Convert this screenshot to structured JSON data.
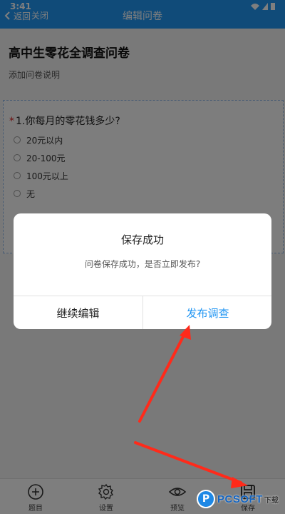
{
  "status_bar": {
    "time": "3:41"
  },
  "header": {
    "back_label": "返回",
    "close_label": "关闭",
    "title": "编辑问卷"
  },
  "survey": {
    "title": "高中生零花全调查问卷",
    "description_placeholder": "添加问卷说明"
  },
  "question": {
    "required_mark": "*",
    "title": "1.你每月的零花钱多少?",
    "options": [
      "20元以内",
      "20-100元",
      "100元以上",
      "无"
    ]
  },
  "dialog": {
    "title": "保存成功",
    "message": "问卷保存成功，是否立即发布?",
    "continue_label": "继续编辑",
    "publish_label": "发布调查"
  },
  "toolbar": {
    "items": [
      {
        "label": "题目",
        "icon": "add-circle-icon"
      },
      {
        "label": "设置",
        "icon": "gear-icon"
      },
      {
        "label": "预览",
        "icon": "eye-icon"
      },
      {
        "label": "保存",
        "icon": "save-icon"
      }
    ]
  },
  "watermark": {
    "badge": "P",
    "text": "PCSOFT",
    "sub": "下载"
  },
  "colors": {
    "primary": "#2196f3",
    "annotation": "#ff2a1a"
  }
}
